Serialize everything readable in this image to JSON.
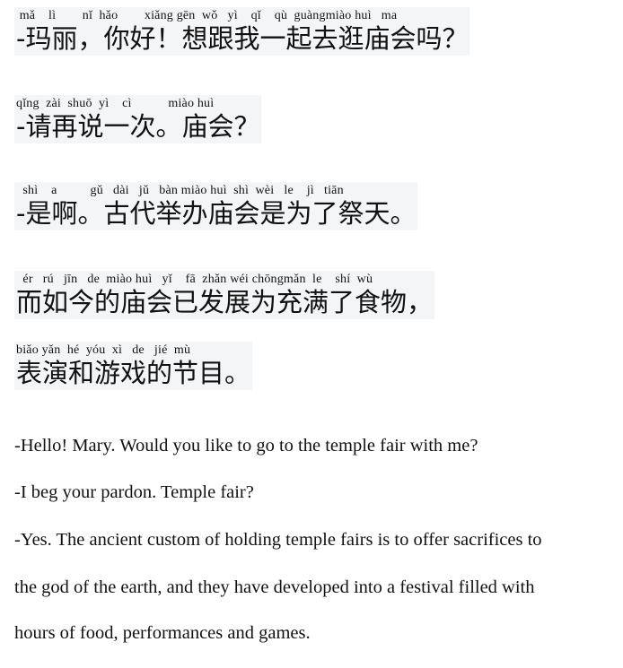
{
  "chinese_lines": [
    {
      "pinyin": " mǎ    lì        nǐ  hǎo        xiǎng gēn  wǒ   yì    qǐ    qù  guàngmiào huì   ma",
      "hanzi": "-玛丽，你好！想跟我一起去逛庙会吗？"
    },
    {
      "pinyin": "qǐng  zài  shuō  yì    cì           miào huì",
      "hanzi": "-请再说一次。庙会？"
    },
    {
      "pinyin": "  shì    a          gǔ   dài   jǔ   bàn miào huì  shì  wèi   le    jì   tiān",
      "hanzi": "-是啊。古代举办庙会是为了祭天。"
    },
    {
      "pinyin": "  ér   rú   jīn   de  miào huì   yǐ    fā  zhǎn wéi chōngmǎn  le    shí  wù",
      "hanzi": "而如今的庙会已发展为充满了食物，"
    },
    {
      "pinyin": "biǎo yǎn  hé  yóu  xì   de   jié  mù",
      "hanzi": "表演和游戏的节目。"
    }
  ],
  "english_lines": [
    "-Hello! Mary. Would you like to go to the temple fair with me?",
    "-I beg your pardon. Temple fair?",
    "-Yes. The ancient custom of holding temple fairs is to offer sacrifices to",
    "the god of the earth, and they have developed into a festival filled with",
    "hours of food, performances and games."
  ]
}
